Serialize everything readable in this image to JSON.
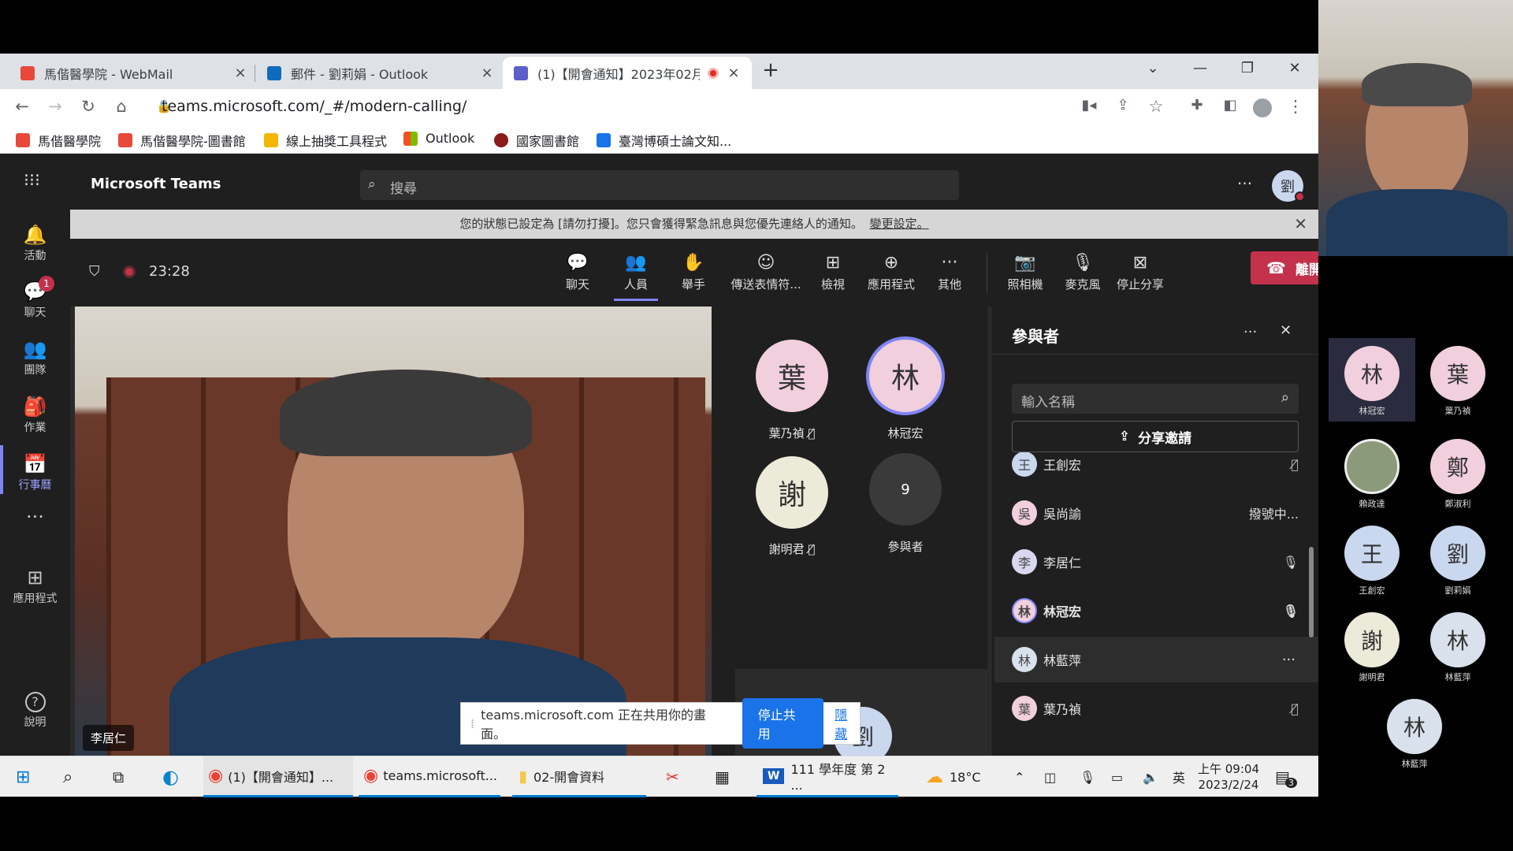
{
  "tabs": [
    {
      "title": "馬偕醫學院 - WebMail",
      "color": "#e8493a"
    },
    {
      "title": "郵件 - 劉莉娟 - Outlook",
      "color": "#0f6cbd"
    },
    {
      "title": "(1)【開會通知】2023年02月",
      "color": "#5b5fc7"
    }
  ],
  "tab_close": "×",
  "tab_new": "+",
  "window": {
    "minimize": "—",
    "restore": "❐",
    "close": "✕",
    "tabsearch": "⌄"
  },
  "address": {
    "url": "teams.microsoft.com/_#/modern-calling/"
  },
  "bookmarks": [
    "馬偕醫學院",
    "馬偕醫學院-圖書館",
    "線上抽獎工具程式",
    "Outlook",
    "國家圖書館",
    "臺灣博碩士論文知..."
  ],
  "teams": {
    "app_title": "Microsoft Teams",
    "search_placeholder": "搜尋",
    "avatar": "劉",
    "rail": [
      {
        "label": "活動",
        "icon": "🔔"
      },
      {
        "label": "聊天",
        "icon": "💬",
        "badge": "1"
      },
      {
        "label": "團隊",
        "icon": "👥"
      },
      {
        "label": "作業",
        "icon": "🎒"
      },
      {
        "label": "行事曆",
        "icon": "📅",
        "active": true
      },
      {
        "label": "",
        "icon": "···"
      },
      {
        "label": "應用程式",
        "icon": "⊞"
      },
      {
        "label": "說明",
        "icon": "?"
      }
    ],
    "banner_text": "您的狀態已設定為 [請勿打擾]。您只會獲得緊急訊息與您優先連絡人的通知。",
    "banner_link": "變更設定。",
    "timer": "23:28",
    "toolbar": [
      {
        "label": "聊天",
        "icon": "💬"
      },
      {
        "label": "人員",
        "icon": "👥"
      },
      {
        "label": "舉手",
        "icon": "✋"
      },
      {
        "label": "傳送表情符...",
        "icon": "☺"
      },
      {
        "label": "檢視",
        "icon": "⊞"
      },
      {
        "label": "應用程式",
        "icon": "⊕"
      },
      {
        "label": "其他",
        "icon": "···"
      },
      {
        "label": "照相機",
        "icon": "📷"
      },
      {
        "label": "麥克風",
        "icon": "🎙"
      },
      {
        "label": "停止分享",
        "icon": "⊠"
      }
    ],
    "leave_label": "離開",
    "video_name": "李居仁",
    "stage_participants": [
      {
        "char": "葉",
        "name": "葉乃禎",
        "color": "#f1cfdc",
        "muted": true
      },
      {
        "char": "林",
        "name": "林冠宏",
        "color": "#f1cfdc",
        "muted": false,
        "speaking": true
      },
      {
        "char": "謝",
        "name": "謝明君",
        "color": "#ecebd9",
        "muted": true
      },
      {
        "char": "9",
        "name": "參與者",
        "color": "#3a3a3a"
      }
    ],
    "self_tile": "劉",
    "panel": {
      "title": "參與者",
      "search_placeholder": "輸入名稱",
      "share_invite": "分享邀請",
      "people": [
        {
          "char": "王",
          "name": "王創宏",
          "color": "#c9d7ef",
          "status": "muted"
        },
        {
          "char": "吳",
          "name": "吳尚諭",
          "color": "#f1cfdc",
          "status": "撥號中..."
        },
        {
          "char": "李",
          "name": "李居仁",
          "color": "#d9d8ee",
          "status": "mic"
        },
        {
          "char": "林",
          "name": "林冠宏",
          "color": "#f1cfdc",
          "status": "mic",
          "bold": true
        },
        {
          "char": "林",
          "name": "林藍萍",
          "color": "#d9e2ec",
          "status": "more",
          "hover": true
        },
        {
          "char": "葉",
          "name": "葉乃禎",
          "color": "#f1cfdc",
          "status": "muted"
        }
      ]
    }
  },
  "share_bar": {
    "text": "teams.microsoft.com 正在共用你的畫面。",
    "stop": "停止共用",
    "hide": "隱藏"
  },
  "taskbar": {
    "items": [
      "(1)【開會通知】...",
      "teams.microsoft...",
      "02-開會資料",
      "111 學年度 第 2 ..."
    ],
    "weather": "18°C",
    "ime": "英",
    "time": "上午 09:04",
    "date": "2023/2/24",
    "notify": "3"
  },
  "gallery": [
    {
      "char": "林",
      "name": "林冠宏",
      "color": "#f1cfdc",
      "highlight": true
    },
    {
      "char": "葉",
      "name": "葉乃禎",
      "color": "#f1cfdc"
    },
    {
      "char": "",
      "name": "賴政達",
      "color": "#8a9a7a",
      "photo": true
    },
    {
      "char": "鄭",
      "name": "鄭淑利",
      "color": "#f1cfdc"
    },
    {
      "char": "王",
      "name": "王創宏",
      "color": "#c9d7ef"
    },
    {
      "char": "劉",
      "name": "劉莉娟",
      "color": "#c9d7ef"
    },
    {
      "char": "謝",
      "name": "謝明君",
      "color": "#ecebd9"
    },
    {
      "char": "林",
      "name": "林藍萍",
      "color": "#d9e2ec"
    },
    {
      "char": "林",
      "name": "林藍萍",
      "color": "#d9e2ec"
    }
  ]
}
